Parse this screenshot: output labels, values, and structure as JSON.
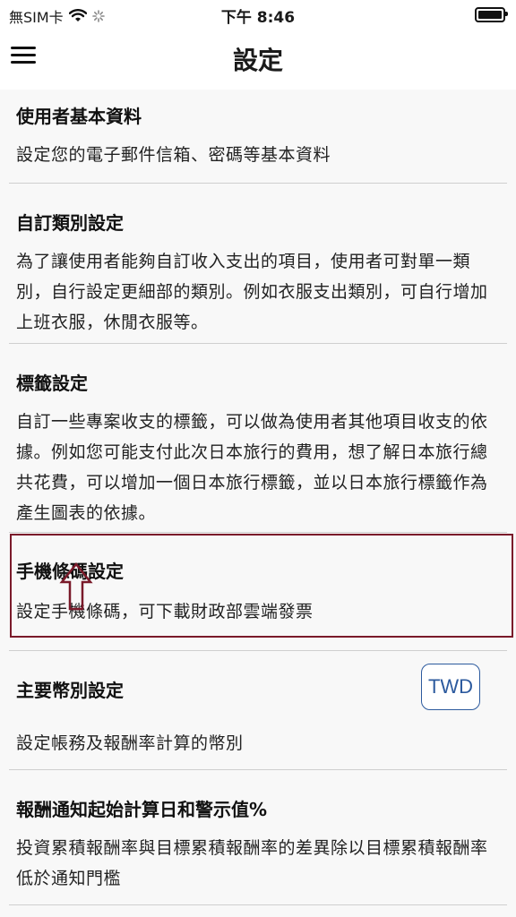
{
  "status_bar": {
    "carrier": "無SIM卡",
    "time": "下午 8:46"
  },
  "nav": {
    "title": "設定",
    "menu_icon": "hamburger-menu-icon"
  },
  "settings": [
    {
      "title": "使用者基本資料",
      "description": "設定您的電子郵件信箱、密碼等基本資料"
    },
    {
      "title": "自訂類別設定",
      "description": "為了讓使用者能夠自訂收入支出的項目，使用者可對單一類別，自行設定更細部的類別。例如衣服支出類別，可自行增加上班衣服，休閒衣服等。"
    },
    {
      "title": "標籤設定",
      "description": "自訂一些專案收支的標籤，可以做為使用者其他項目收支的依據。例如您可能支付此次日本旅行的費用，想了解日本旅行總共花費，可以增加一個日本旅行標籤，並以日本旅行標籤作為產生圖表的依據。"
    },
    {
      "title": "手機條碼設定",
      "description": "設定手機條碼，可下載財政部雲端發票"
    },
    {
      "title": "主要幣別設定",
      "description": "設定帳務及報酬率計算的幣別",
      "currency": "TWD"
    },
    {
      "title": "報酬通知起始計算日和警示值%",
      "description": "投資累積報酬率與目標累積報酬率的差異除以目標累積報酬率低於通知門檻"
    }
  ],
  "colors": {
    "highlight_border": "#7a1a2a",
    "currency_accent": "#2c5a9e"
  }
}
